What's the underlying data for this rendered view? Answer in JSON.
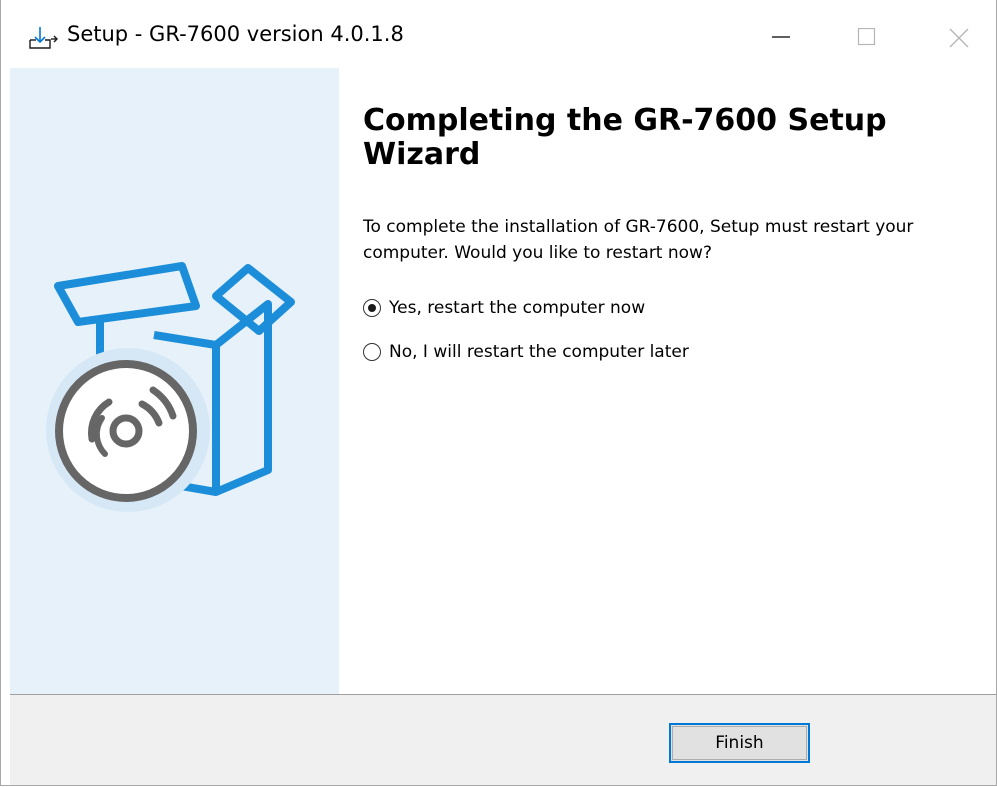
{
  "window": {
    "title": "Setup - GR-7600 version 4.0.1.8",
    "icon": "download-installer-icon",
    "controls": {
      "minimize": "minimize-icon",
      "maximize": "maximize-icon",
      "close": "close-icon"
    }
  },
  "side_panel": {
    "illustration": "software-box-with-disc-icon",
    "colors": {
      "background": "#e6f1fa",
      "box": "#1c8ed9",
      "disc": "#666666"
    }
  },
  "main": {
    "heading": "Completing the GR-7600 Setup Wizard",
    "description": "To complete the installation of GR-7600, Setup must restart your computer. Would you like to restart now?",
    "options": [
      {
        "label": "Yes, restart the computer now",
        "selected": true
      },
      {
        "label": "No, I will restart the computer later",
        "selected": false
      }
    ]
  },
  "footer": {
    "finish_label": "Finish",
    "accent": "#0078d7"
  }
}
